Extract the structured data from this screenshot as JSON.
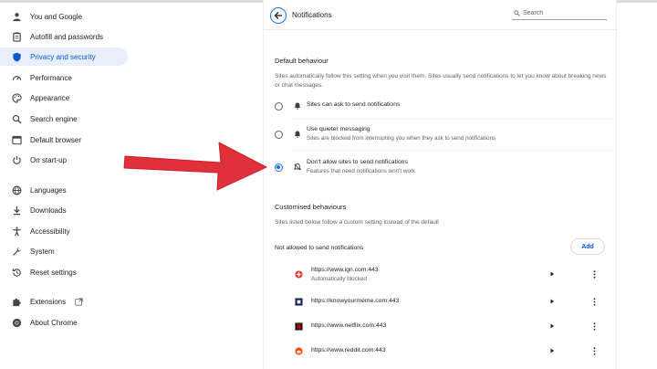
{
  "sidebar": {
    "items": [
      {
        "label": "You and Google",
        "icon": "person-icon",
        "active": false
      },
      {
        "label": "Autofill and passwords",
        "icon": "clipboard-icon",
        "active": false
      },
      {
        "label": "Privacy and security",
        "icon": "shield-icon",
        "active": true
      },
      {
        "label": "Performance",
        "icon": "speedometer-icon",
        "active": false
      },
      {
        "label": "Appearance",
        "icon": "palette-icon",
        "active": false
      },
      {
        "label": "Search engine",
        "icon": "search-icon",
        "active": false
      },
      {
        "label": "Default browser",
        "icon": "browser-window-icon",
        "active": false
      },
      {
        "label": "On start-up",
        "icon": "power-icon",
        "active": false
      },
      {
        "label": "Languages",
        "icon": "globe-icon",
        "active": false
      },
      {
        "label": "Downloads",
        "icon": "download-icon",
        "active": false
      },
      {
        "label": "Accessibility",
        "icon": "accessibility-icon",
        "active": false
      },
      {
        "label": "System",
        "icon": "wrench-icon",
        "active": false
      },
      {
        "label": "Reset settings",
        "icon": "reset-icon",
        "active": false
      },
      {
        "label": "Extensions",
        "icon": "puzzle-icon",
        "active": false
      },
      {
        "label": "About Chrome",
        "icon": "chrome-icon",
        "active": false
      }
    ]
  },
  "header": {
    "title": "Notifications",
    "search_placeholder": "Search"
  },
  "default_behaviour": {
    "heading": "Default behaviour",
    "description": "Sites automatically follow this setting when you visit them. Sites usually send notifications to let you know about breaking news or chat messages.",
    "options": [
      {
        "label": "Sites can ask to send notifications",
        "sub": "",
        "icon": "bell-icon",
        "checked": false
      },
      {
        "label": "Use quieter messaging",
        "sub": "Sites are blocked from interrupting you when they ask to send notifications",
        "icon": "bell-icon",
        "checked": false
      },
      {
        "label": "Don't allow sites to send notifications",
        "sub": "Features that need notifications won't work",
        "icon": "bell-off-icon",
        "checked": true
      }
    ]
  },
  "customised_behaviours": {
    "heading": "Customised behaviours",
    "description": "Sites listed below follow a custom setting instead of the default",
    "not_allowed_heading": "Not allowed to send notifications",
    "add_label": "Add",
    "sites": [
      {
        "url": "https://www.ign.com:443",
        "sub": "Automatically blocked",
        "icon": "ign-favicon-icon",
        "color": "#e8392b"
      },
      {
        "url": "https://knowyourmeme.com:443",
        "sub": "",
        "icon": "knowyourmeme-favicon-icon",
        "color": "#1a2a5e"
      },
      {
        "url": "https://www.netflix.com:443",
        "sub": "",
        "icon": "netflix-favicon-icon",
        "color": "#e50914"
      },
      {
        "url": "https://www.reddit.com:443",
        "sub": "",
        "icon": "reddit-favicon-icon",
        "color": "#ff4500"
      }
    ]
  },
  "colors": {
    "accent": "#1a73e8",
    "active_bg": "#e8eefa",
    "annotation_arrow": "#e0303a"
  }
}
